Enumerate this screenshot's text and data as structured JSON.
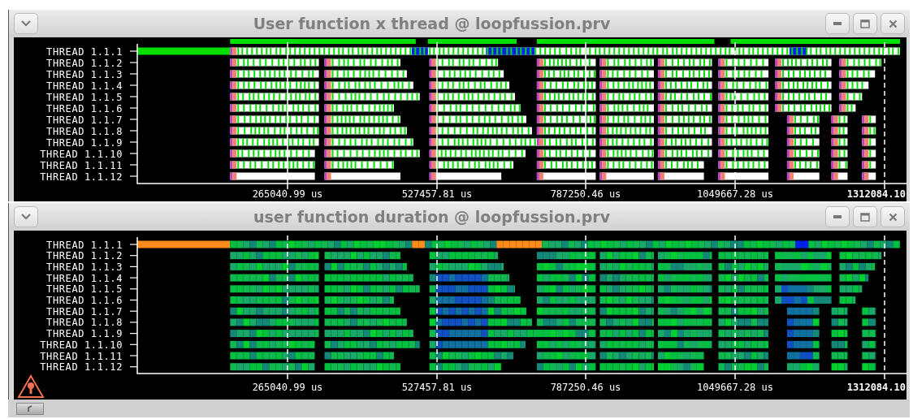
{
  "windows": [
    {
      "title": "User function x thread @ loopfussion.prv",
      "kind": "events",
      "warning": false,
      "threads": [
        "THREAD 1.1.1",
        "THREAD 1.1.2",
        "THREAD 1.1.3",
        "THREAD 1.1.4",
        "THREAD 1.1.5",
        "THREAD 1.1.6",
        "THREAD 1.1.7",
        "THREAD 1.1.8",
        "THREAD 1.1.9",
        "THREAD 1.1.10",
        "THREAD 1.1.11",
        "THREAD 1.1.12"
      ],
      "ticks": [
        "265040.99 us",
        "527457.81 us",
        "787250.46 us",
        "1049667.28 us",
        "1312084.10"
      ]
    },
    {
      "title": "user function duration @ loopfussion.prv",
      "kind": "gradient",
      "warning": true,
      "threads": [
        "THREAD 1.1.1",
        "THREAD 1.1.2",
        "THREAD 1.1.3",
        "THREAD 1.1.4",
        "THREAD 1.1.5",
        "THREAD 1.1.6",
        "THREAD 1.1.7",
        "THREAD 1.1.8",
        "THREAD 1.1.9",
        "THREAD 1.1.10",
        "THREAD 1.1.11",
        "THREAD 1.1.12"
      ],
      "ticks": [
        "265040.99 us",
        "527457.81 us",
        "787250.46 us",
        "1049667.28 us",
        "1312084.10"
      ]
    }
  ]
}
